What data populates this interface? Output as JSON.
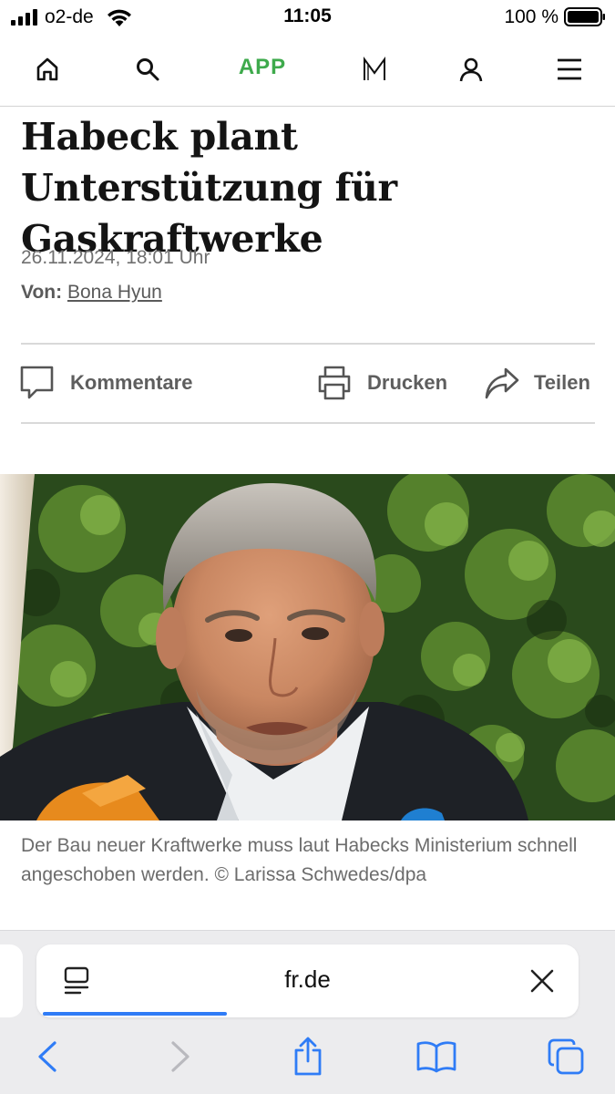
{
  "status_bar": {
    "carrier": "o2-de",
    "time": "11:05",
    "battery": "100 %",
    "signal_icon": "cellular-signal-icon",
    "wifi_icon": "wifi-icon",
    "battery_icon": "battery-full-icon"
  },
  "header": {
    "nav": [
      {
        "icon": "home-icon"
      },
      {
        "icon": "search-icon"
      },
      {
        "label": "APP"
      },
      {
        "icon": "fr-logo-icon"
      },
      {
        "icon": "user-icon"
      },
      {
        "icon": "menu-icon"
      }
    ],
    "app_label": "APP",
    "accent_color": "#3eaa4c"
  },
  "article": {
    "headline": "Habeck plant Unterstützung für Gaskraftwerke",
    "date": "26.11.2024, 18:01 Uhr",
    "byline_prefix": "Von:",
    "author": "Bona Hyun",
    "actions": {
      "comments": "Kommentare",
      "print": "Drucken",
      "share": "Teilen"
    },
    "image_caption": "Der Bau neuer Kraftwerke muss laut Habecks Ministerium schnell angeschoben werden. © Larissa Schwedes/dpa"
  },
  "browser": {
    "url": "fr.de",
    "load_progress": 0.34,
    "progress_color": "#2f7cf6",
    "toolbar": [
      "back-icon",
      "forward-icon",
      "share-icon",
      "bookmarks-icon",
      "tabs-icon"
    ]
  }
}
